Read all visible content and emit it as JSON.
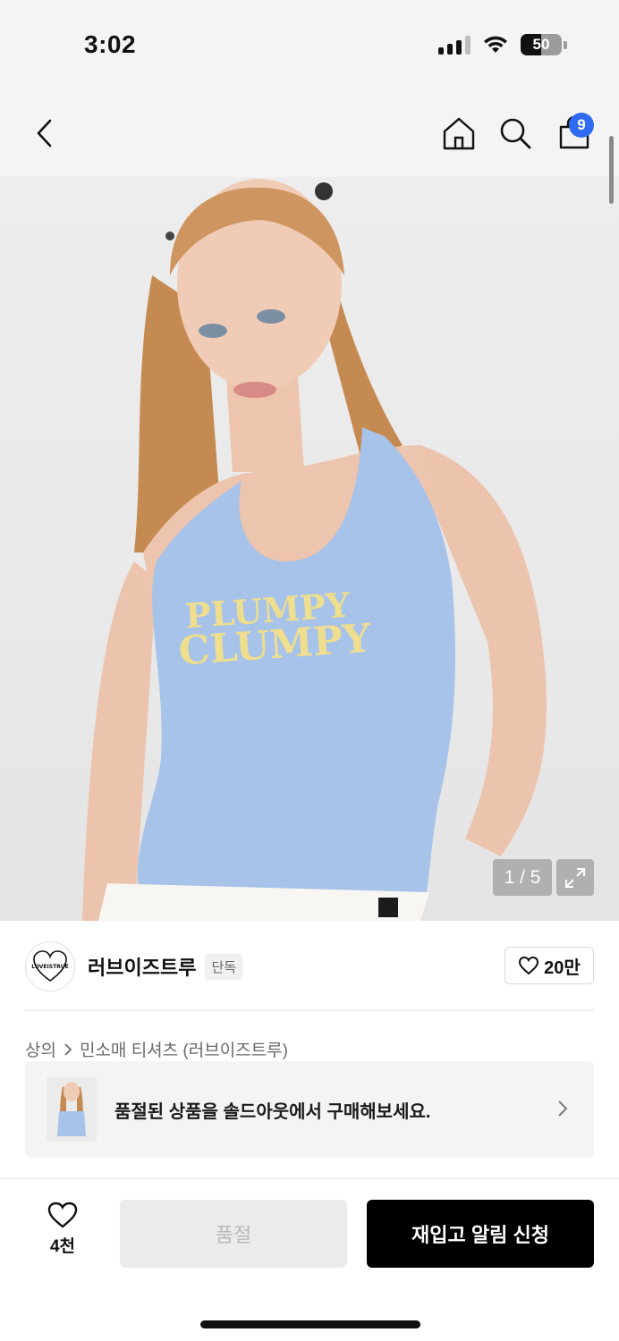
{
  "status_bar": {
    "time": "3:02",
    "battery": "50",
    "battery_level": 0.5,
    "icons": [
      "signal-icon",
      "wifi-icon",
      "battery-icon"
    ]
  },
  "nav": {
    "icons": [
      "back-icon",
      "home-icon",
      "search-icon",
      "cart-icon"
    ],
    "cart_badge": "9",
    "badge_color": "#2f6bf2"
  },
  "gallery": {
    "counter": "1 / 5",
    "shirt_print": [
      "PLUMPY",
      "CLUMPY"
    ],
    "icons": [
      "expand-icon"
    ]
  },
  "brand": {
    "name": "러브이즈트루",
    "tag": "단독",
    "likes": "20만",
    "logo_text": "LOVEISTRUE"
  },
  "breadcrumb": {
    "items": [
      "상의",
      "민소매 티셔츠 (러브이즈트루)"
    ]
  },
  "soldout_banner": {
    "text": "품절된 상품을 솔드아웃에서 구매해보세요."
  },
  "bottom_bar": {
    "wish_count": "4천",
    "soldout_label": "품절",
    "restock_label": "재입고 알림 신청",
    "primary_color": "#000000"
  }
}
